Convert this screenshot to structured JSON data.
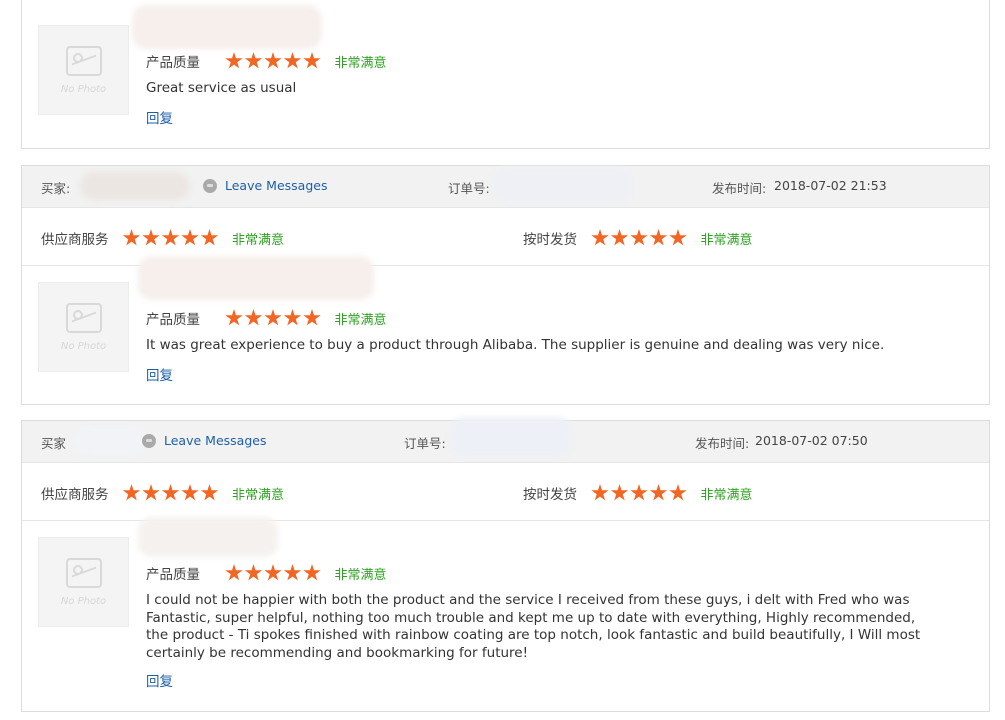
{
  "labels": {
    "buyer_colon": "买家:",
    "buyer_plain": "买家",
    "leave_messages": "Leave Messages",
    "order_no": "订单号:",
    "publish_time": "发布时间:",
    "supplier_service": "供应商服务",
    "on_time_delivery": "按时发货",
    "product_quality": "产品质量",
    "very_satisfied": "非常满意",
    "reply": "回复",
    "no_photo": "No Photo"
  },
  "reviews": [
    {
      "product_rating": 5,
      "comment": "Great service as usual"
    },
    {
      "time": "2018-07-02 21:53",
      "supplier_service_rating": 5,
      "on_time_delivery_rating": 5,
      "product_rating": 5,
      "comment": "It was great experience to buy a product through Alibaba. The supplier is genuine and dealing was very nice."
    },
    {
      "time": "2018-07-02 07:50",
      "supplier_service_rating": 5,
      "on_time_delivery_rating": 5,
      "product_rating": 5,
      "comment": "I could not be happier with both the product and the service I received from these guys, i delt with Fred who was Fantastic, super helpful, nothing too much trouble and kept me up to date with everything, Highly recommended, the product - Ti spokes finished with rainbow coating are top notch, look fantastic and build beautifully, I Will most certainly be recommending and bookmarking for future!"
    }
  ],
  "colors": {
    "star": "#f26522",
    "satisfied_text": "#2ea121",
    "link": "#1e5fa8",
    "header_bg": "#f2f2f2"
  }
}
